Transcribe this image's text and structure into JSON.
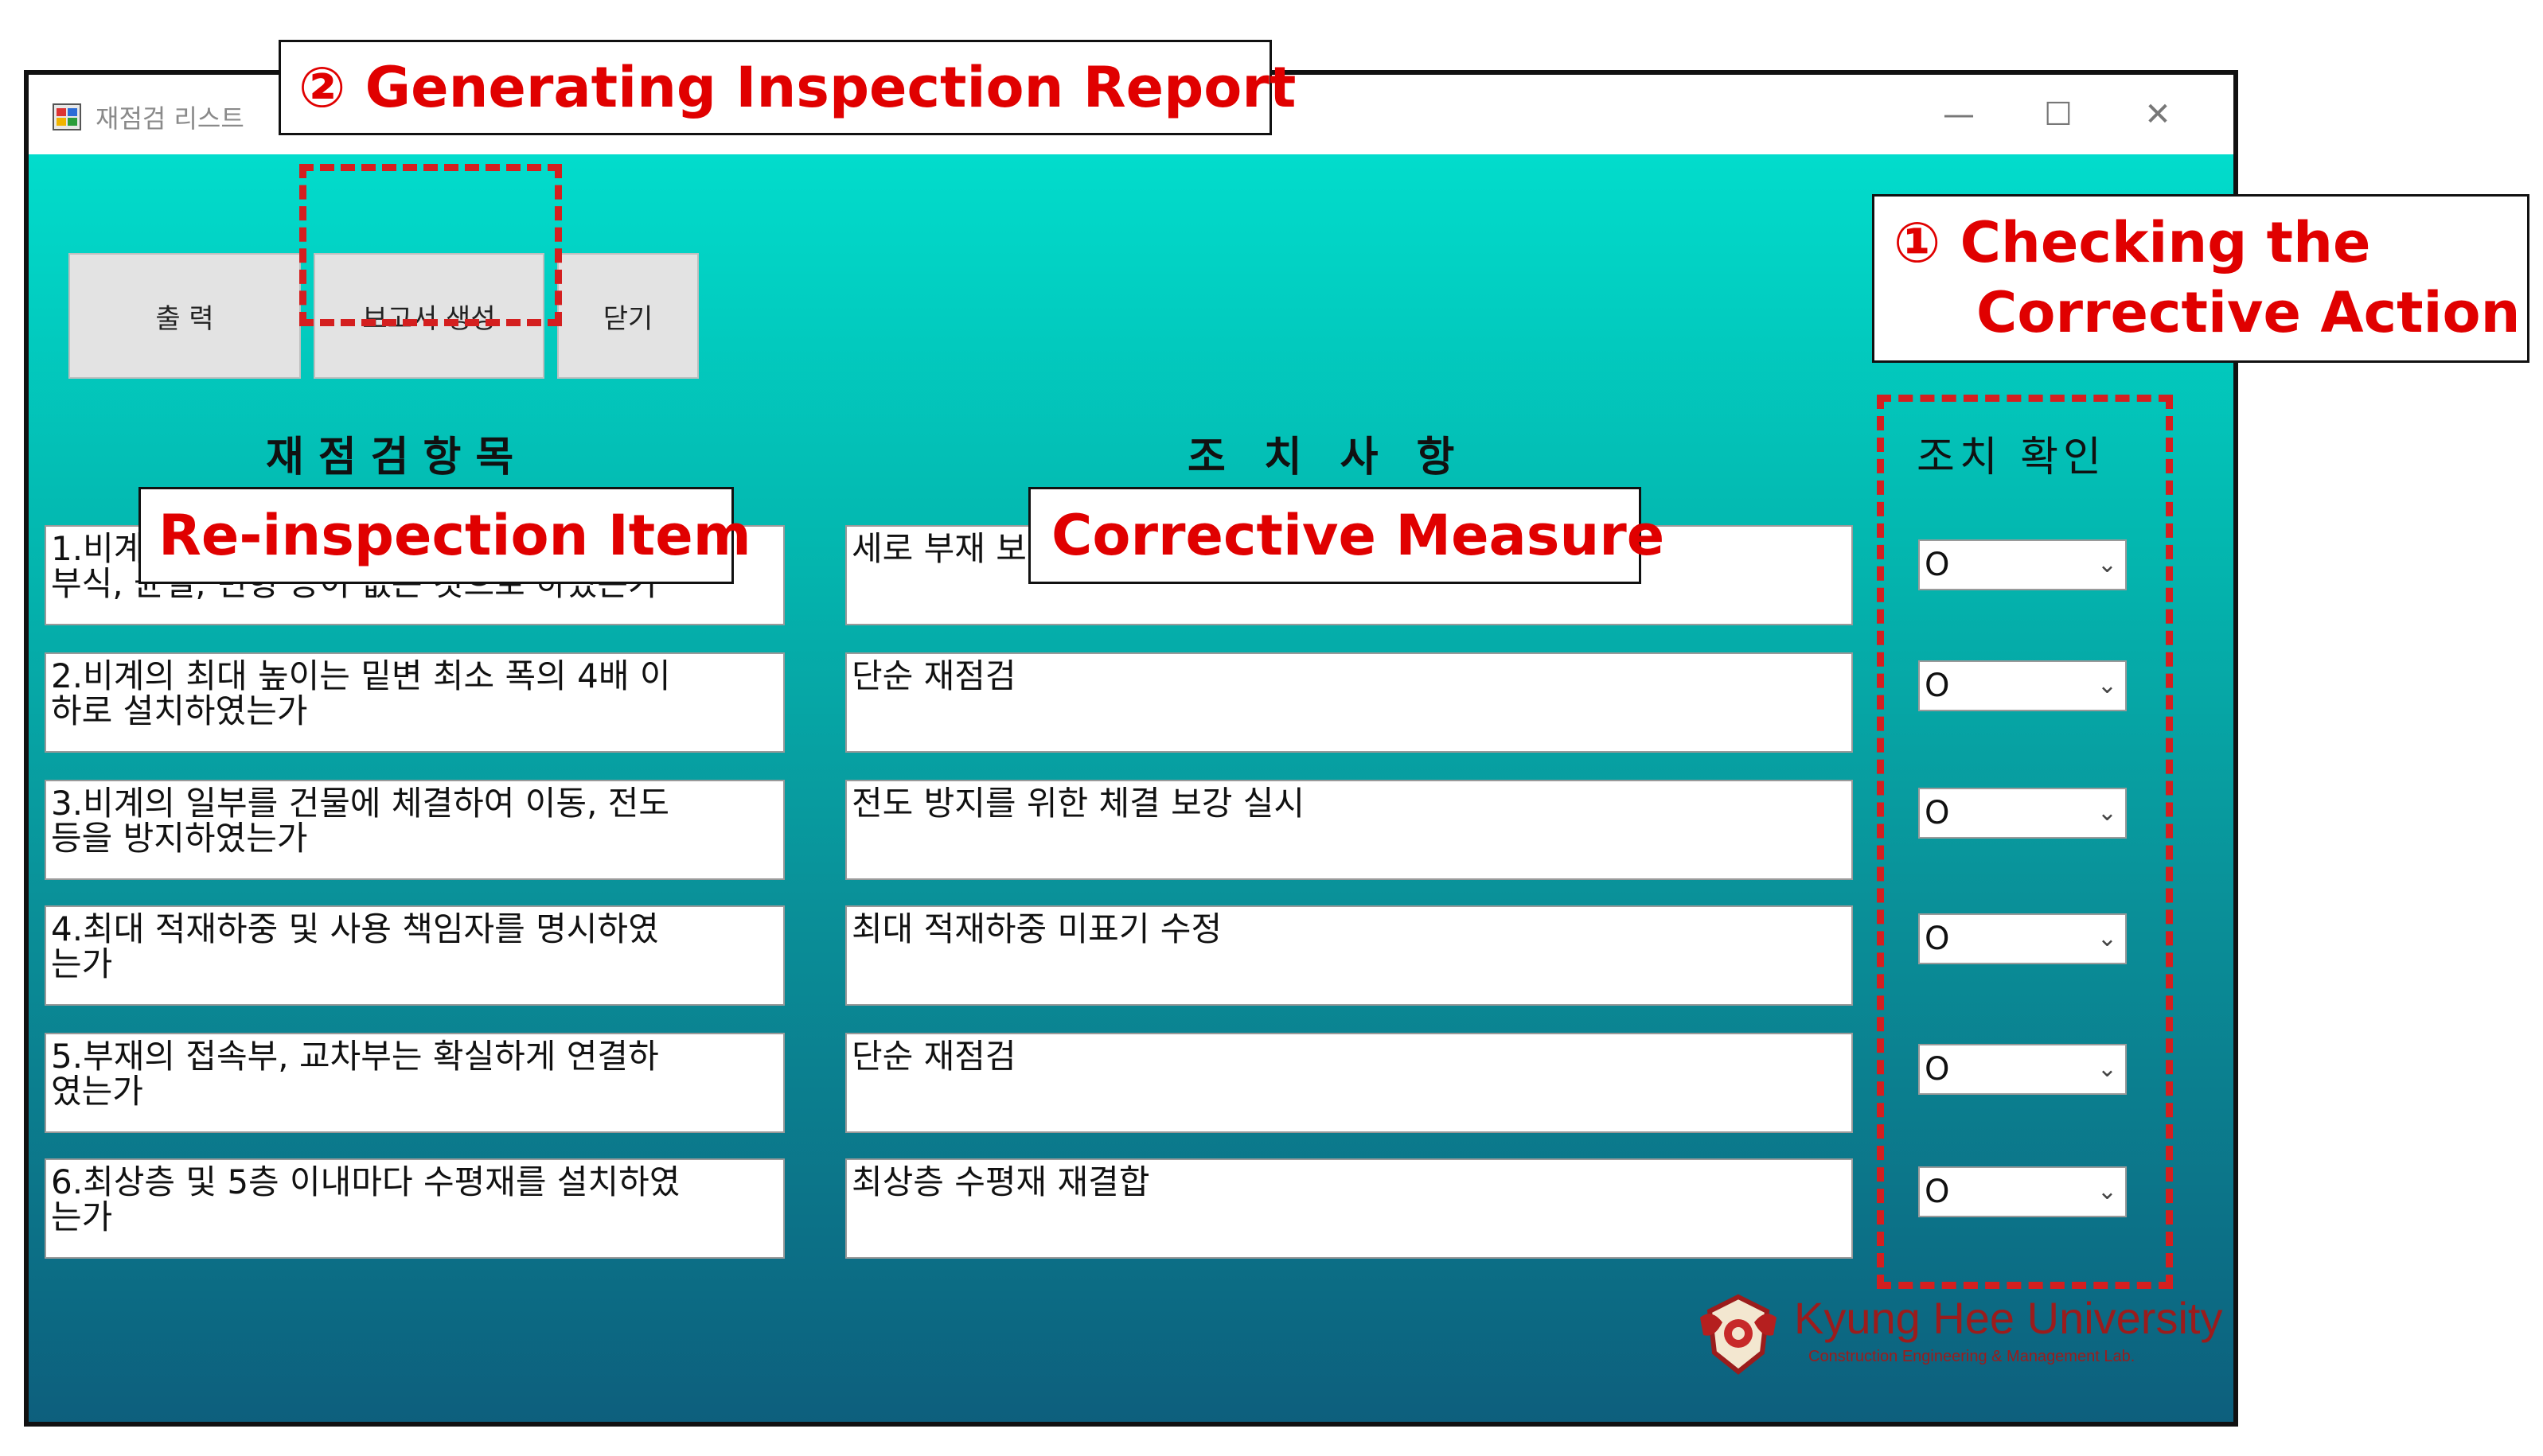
{
  "window": {
    "title": "재점검 리스트",
    "controls": {
      "minimize": "—",
      "maximize": "☐",
      "close": "✕"
    }
  },
  "toolbar": {
    "print_label": "출  력",
    "report_label": "보고서 생성",
    "close_label": "닫기"
  },
  "headers": {
    "items": "재점검항목",
    "measures": "조치사항",
    "confirm": "조치 확인"
  },
  "rows": [
    {
      "item_line1": "1.비계",
      "item_line2": "부식, 균열, 변형 등이 없는 것으로 하였는가",
      "measure": "세로 부재 보",
      "confirm": "O"
    },
    {
      "item_line1": "2.비계의 최대 높이는 밑변 최소 폭의 4배 이",
      "item_line2": "하로 설치하였는가",
      "measure": "단순 재점검",
      "confirm": "O"
    },
    {
      "item_line1": "3.비계의 일부를 건물에 체결하여 이동, 전도",
      "item_line2": "등을 방지하였는가",
      "measure": "전도 방지를 위한 체결 보강 실시",
      "confirm": "O"
    },
    {
      "item_line1": "4.최대 적재하중 및 사용 책임자를 명시하였",
      "item_line2": "는가",
      "measure": "최대 적재하중 미표기 수정",
      "confirm": "O"
    },
    {
      "item_line1": "5.부재의 접속부, 교차부는 확실하게 연결하",
      "item_line2": "였는가",
      "measure": "단순 재점검",
      "confirm": "O"
    },
    {
      "item_line1": "6.최상층 및 5층 이내마다 수평재를 설치하였",
      "item_line2": "는가",
      "measure": "최상층 수평재 재결합",
      "confirm": "O"
    }
  ],
  "annotations": {
    "report": "② Generating Inspection Report",
    "checking_line1": "① Checking the",
    "checking_line2": "Corrective Action",
    "reinspection": "Re-inspection Item",
    "corrective": "Corrective Measure"
  },
  "logo": {
    "name": "Kyung Hee University",
    "subtitle": "Construction Engineering & Management Lab."
  },
  "colors": {
    "annotation_red": "#d41f1f",
    "client_top": "#02dccc",
    "client_bottom": "#0d5f7d"
  }
}
